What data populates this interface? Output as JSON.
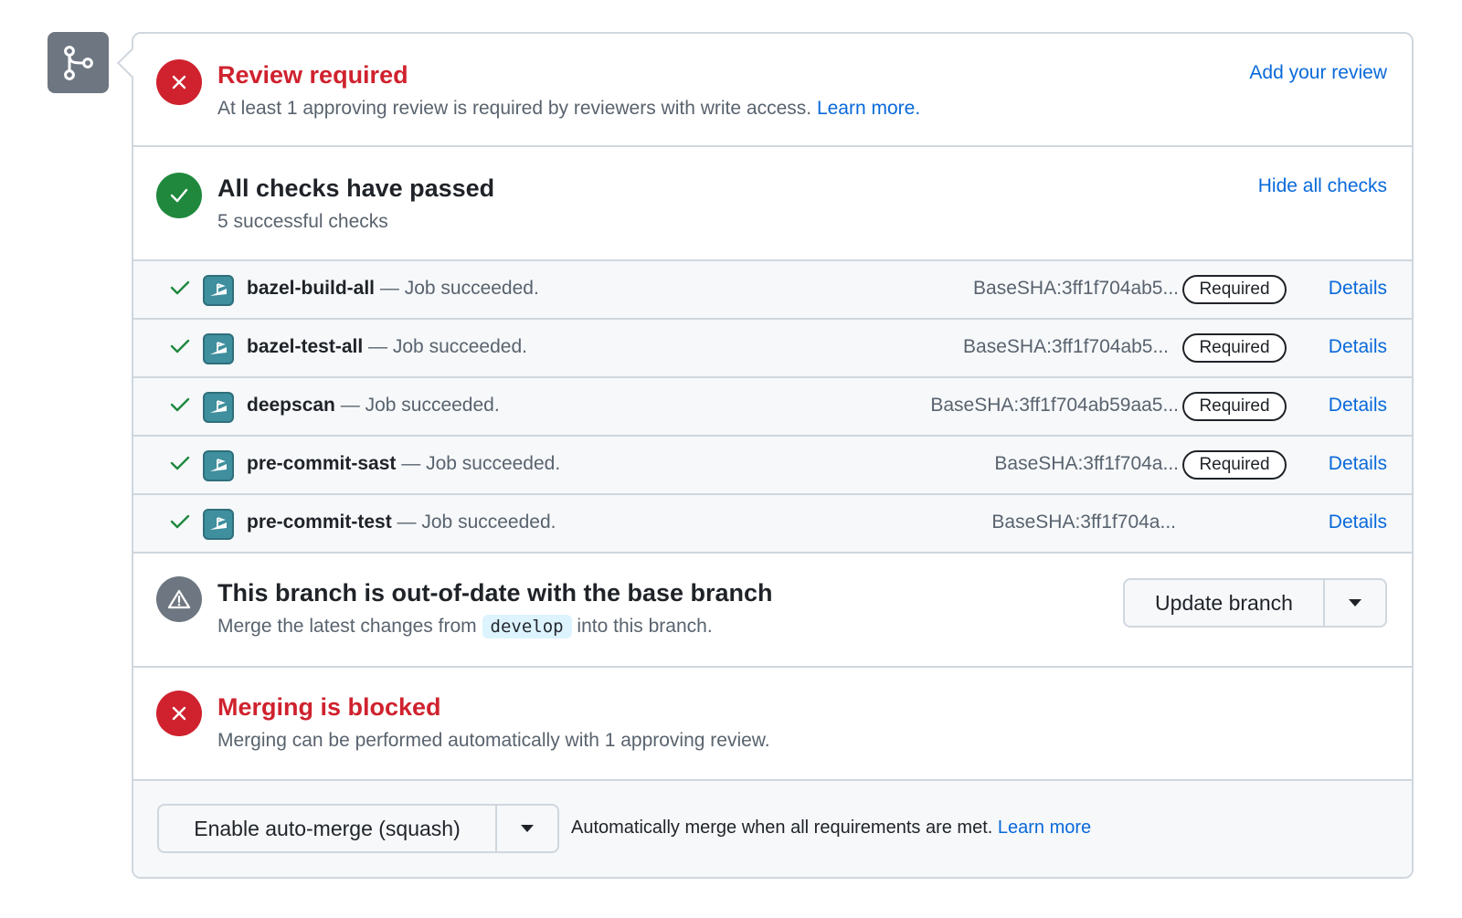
{
  "icons": {
    "merge": "git-branch-icon",
    "x": "x-icon",
    "check": "check-icon",
    "warning": "alert-icon",
    "app": "app-logo-icon",
    "caret": "triangle-down-icon"
  },
  "colors": {
    "danger": "#cf222e",
    "success": "#1f883d",
    "neutral": "#6e7781",
    "link": "#0969da"
  },
  "review": {
    "title": "Review required",
    "desc": "At least 1 approving review is required by reviewers with write access.",
    "learn_more": "Learn more.",
    "action": "Add your review"
  },
  "checks": {
    "title": "All checks have passed",
    "desc": "5 successful checks",
    "action": "Hide all checks",
    "items": [
      {
        "name": "bazel-build-all",
        "status": "— Job succeeded.",
        "sha": "BaseSHA:3ff1f704ab5...",
        "badge": "Required",
        "details": "Details"
      },
      {
        "name": "bazel-test-all",
        "status": "— Job succeeded.",
        "sha": "BaseSHA:3ff1f704ab5...",
        "badge": "Required",
        "details": "Details"
      },
      {
        "name": "deepscan",
        "status": "— Job succeeded.",
        "sha": "BaseSHA:3ff1f704ab59aa5...",
        "badge": "Required",
        "details": "Details"
      },
      {
        "name": "pre-commit-sast",
        "status": "— Job succeeded.",
        "sha": "BaseSHA:3ff1f704a...",
        "badge": "Required",
        "details": "Details"
      },
      {
        "name": "pre-commit-test",
        "status": "— Job succeeded.",
        "sha": "BaseSHA:3ff1f704a...",
        "badge": "",
        "details": "Details"
      }
    ]
  },
  "outdated": {
    "title": "This branch is out-of-date with the base branch",
    "desc_before": "Merge the latest changes from",
    "branch": "develop",
    "desc_after": "into this branch.",
    "button": "Update branch"
  },
  "blocked": {
    "title": "Merging is blocked",
    "desc": "Merging can be performed automatically with 1 approving review."
  },
  "footer": {
    "button": "Enable auto-merge (squash)",
    "text": "Automatically merge when all requirements are met.",
    "learn_more": "Learn more"
  }
}
